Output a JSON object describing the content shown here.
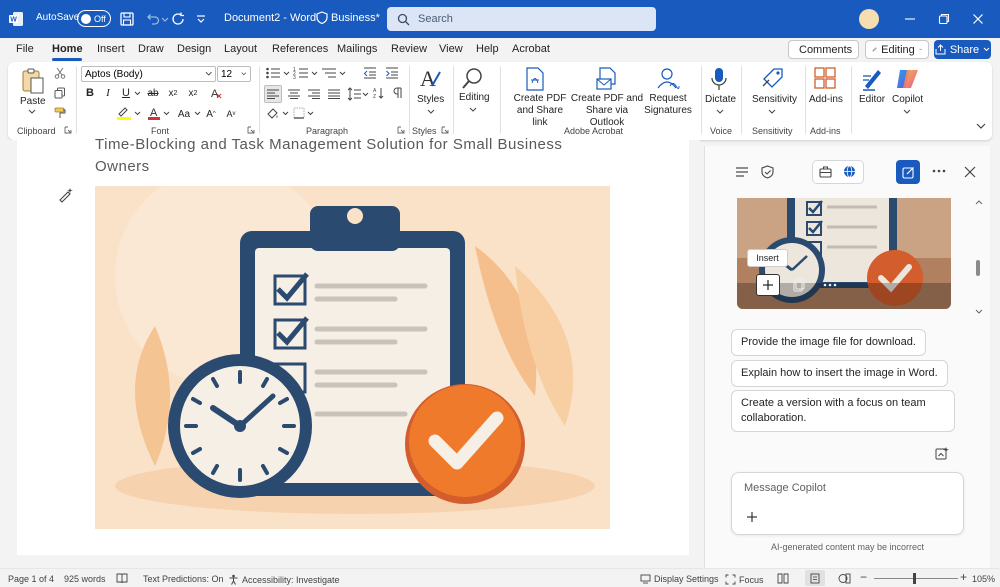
{
  "titlebar": {
    "autosave_label": "AutoSave",
    "autosave_state": "Off",
    "doc_title": "Document2 - Word",
    "sensitivity": "Business*",
    "search_placeholder": "Search"
  },
  "menu": {
    "tabs": [
      "File",
      "Home",
      "Insert",
      "Draw",
      "Design",
      "Layout",
      "References",
      "Mailings",
      "Review",
      "View",
      "Help",
      "Acrobat"
    ],
    "comments": "Comments",
    "editing": "Editing",
    "share": "Share"
  },
  "ribbon": {
    "paste": "Paste",
    "clipboard": "Clipboard",
    "font_name": "Aptos (Body)",
    "font_size": "12",
    "font": "Font",
    "paragraph": "Paragraph",
    "styles": "Styles",
    "styles_group": "Styles",
    "editing": "Editing",
    "create_pdf_1": "Create PDF",
    "create_pdf_2": "and Share link",
    "create_pdf_outlook_1": "Create PDF and",
    "create_pdf_outlook_2": "Share via Outlook",
    "request_sig_1": "Request",
    "request_sig_2": "Signatures",
    "adobe_acrobat": "Adobe Acrobat",
    "dictate": "Dictate",
    "voice": "Voice",
    "sensitivity": "Sensitivity",
    "sensitivity_group": "Sensitivity",
    "addins": "Add-ins",
    "addins_group": "Add-ins",
    "editor": "Editor",
    "copilot": "Copilot"
  },
  "document": {
    "heading_line1": "Time-Blocking and Task Management Solution for Small Business",
    "heading_line2": "Owners"
  },
  "copilot": {
    "tooltip": "Insert",
    "suggestions": [
      "Provide the image file for download.",
      "Explain how to insert the image in Word.",
      "Create a version with a focus on team collaboration."
    ],
    "message_placeholder": "Message Copilot",
    "disclaimer": "AI-generated content may be incorrect"
  },
  "status": {
    "page": "Page 1 of 4",
    "words": "925 words",
    "text_predictions": "Text Predictions: On",
    "accessibility": "Accessibility: Investigate",
    "display_settings": "Display Settings",
    "focus": "Focus",
    "zoom": "105%"
  },
  "colors": {
    "brand": "#185abd",
    "orange": "#f07a2c",
    "navy": "#2b4a6f"
  }
}
